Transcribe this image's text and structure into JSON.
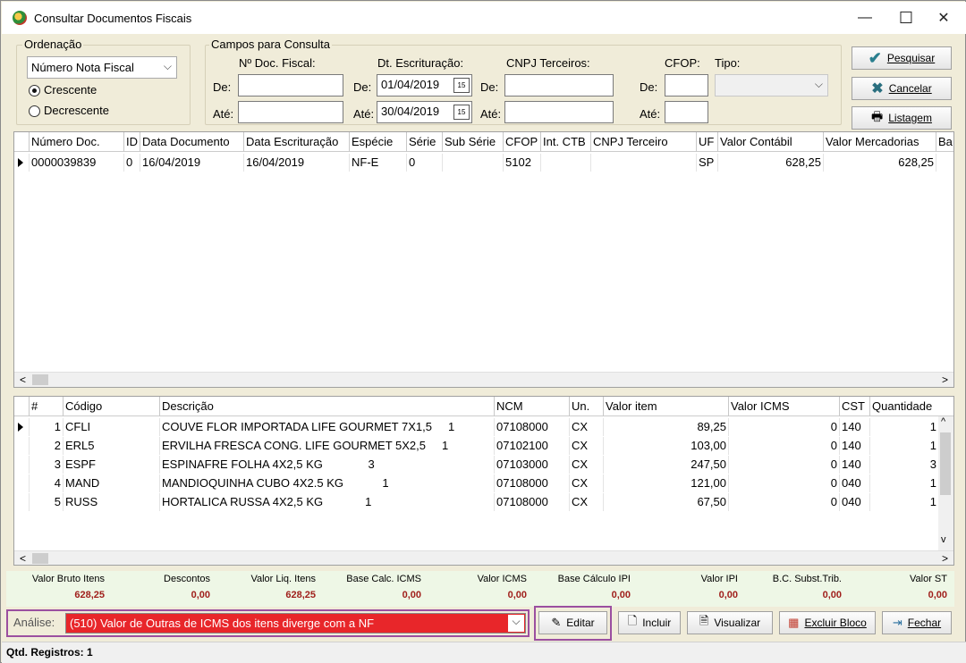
{
  "window": {
    "title": "Consultar Documentos Fiscais",
    "min": "—",
    "max": "☐",
    "close": "✕"
  },
  "ordenacao": {
    "label": "Ordenação",
    "select": "Número Nota Fiscal",
    "radio_crescente": "Crescente",
    "radio_decrescente": "Decrescente",
    "selected": "Crescente"
  },
  "campos": {
    "label": "Campos para Consulta",
    "nro_doc_label": "Nº Doc. Fiscal:",
    "dt_esc_label": "Dt. Escrituração:",
    "cnpj_label": "CNPJ Terceiros:",
    "cfop_label": "CFOP:",
    "tipo_label": "Tipo:",
    "de": "De:",
    "ate": "Até:",
    "nro_de": "",
    "nro_ate": "",
    "dt_de": "01/04/2019",
    "dt_ate": "30/04/2019",
    "cnpj_de": "",
    "cnpj_ate": "",
    "cfop_de": "",
    "cfop_ate": "",
    "tipo": ""
  },
  "buttons": {
    "pesquisar": "Pesquisar",
    "cancelar": "Cancelar",
    "listagem": "Listagem"
  },
  "docs_grid": {
    "headers": [
      "Número Doc.",
      "ID",
      "Data Documento",
      "Data Escrituração",
      "Espécie",
      "Série",
      "Sub Série",
      "CFOP",
      "Int. CTB",
      "CNPJ Terceiro",
      "UF",
      "Valor Contábil",
      "Valor Mercadorias",
      "Ba"
    ],
    "rows": [
      [
        "0000039839",
        "0",
        "16/04/2019",
        "16/04/2019",
        "NF-E",
        "0",
        "",
        "5102",
        "",
        "",
        "SP",
        "628,25",
        "628,25",
        ""
      ]
    ]
  },
  "items_grid": {
    "headers": [
      "#",
      "Código",
      "Descrição",
      "NCM",
      "Un.",
      "Valor item",
      "Valor ICMS",
      "CST",
      "Quantidade"
    ],
    "rows": [
      [
        "1",
        "CFLI",
        "COUVE FLOR IMPORTADA LIFE GOURMET 7X1,5     1",
        "07108000",
        "CX",
        "89,25",
        "0",
        "140",
        "1"
      ],
      [
        "2",
        "ERL5",
        "ERVILHA FRESCA CONG. LIFE GOURMET 5X2,5     1",
        "07102100",
        "CX",
        "103,00",
        "0",
        "140",
        "1"
      ],
      [
        "3",
        "ESPF",
        "ESPINAFRE FOLHA 4X2,5 KG              3",
        "07103000",
        "CX",
        "247,50",
        "0",
        "140",
        "3"
      ],
      [
        "4",
        "MAND",
        "MANDIOQUINHA CUBO 4X2.5 KG            1",
        "07108000",
        "CX",
        "121,00",
        "0",
        "040",
        "1"
      ],
      [
        "5",
        "RUSS",
        "HORTALICA RUSSA 4X2,5 KG             1",
        "07108000",
        "CX",
        "67,50",
        "0",
        "040",
        "1"
      ]
    ]
  },
  "totals": {
    "labels": [
      "Valor Bruto Itens",
      "Descontos",
      "Valor Liq. Itens",
      "Base Calc. ICMS",
      "Valor ICMS",
      "Base Cálculo IPI",
      "Valor IPI",
      "B.C. Subst.Trib.",
      "Valor ST"
    ],
    "values": [
      "628,25",
      "0,00",
      "628,25",
      "0,00",
      "0,00",
      "0,00",
      "0,00",
      "0,00",
      "0,00"
    ]
  },
  "analise": {
    "label": "Análise:",
    "value": "(510) Valor de Outras de ICMS dos itens diverge com a NF"
  },
  "actions": {
    "editar": "Editar",
    "incluir": "Incluir",
    "visualizar": "Visualizar",
    "excluir_bloco": "Excluir Bloco",
    "fechar": "Fechar"
  },
  "status": "Qtd. Registros: 1",
  "colors": {
    "bg": "#f0ecd9",
    "totals_bg": "#eef7e6",
    "totals_value": "#a0201c",
    "analise_bg": "#e8262a",
    "highlight": "#9b4fa0"
  }
}
